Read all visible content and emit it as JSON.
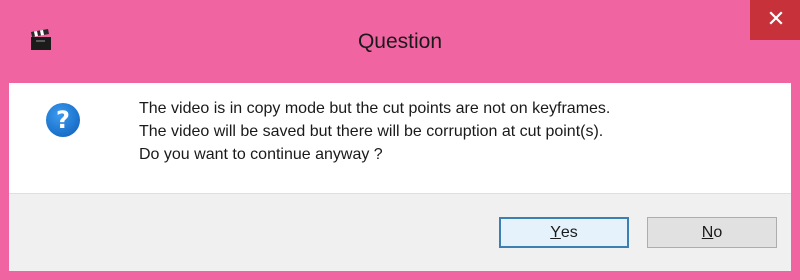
{
  "window": {
    "title": "Question",
    "accent_color": "#f064a2",
    "close_color": "#c7323a",
    "app_icon": "clapperboard-icon",
    "close_icon": "close-icon"
  },
  "dialog": {
    "icon": "question-icon",
    "icon_glyph": "?",
    "message_lines": [
      "The video is in copy mode but the cut points are not on keyframes.",
      "The video will be saved but there will be corruption at cut point(s).",
      "Do you want to continue anyway ?"
    ]
  },
  "buttons": {
    "yes": {
      "mnemonic": "Y",
      "rest": "es",
      "default": true
    },
    "no": {
      "mnemonic": "N",
      "rest": "o",
      "default": false
    }
  }
}
